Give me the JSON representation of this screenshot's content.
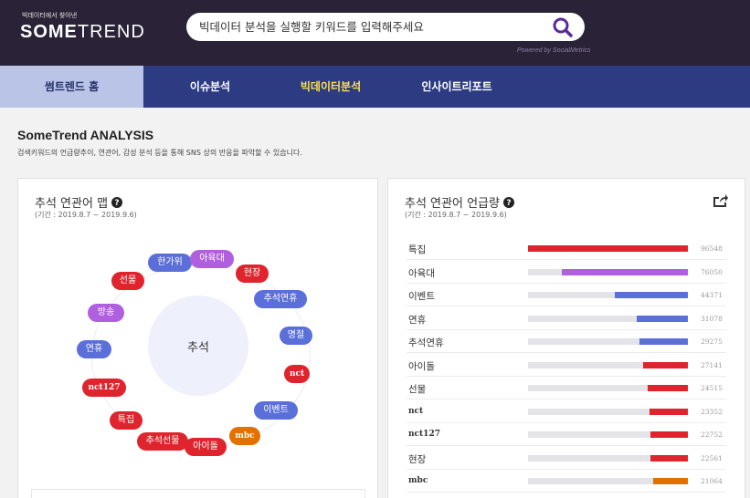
{
  "header": {
    "tagline": "빅데이터에서 찾아낸",
    "logo_bold": "SOME",
    "logo_light": "TREND",
    "search_placeholder": "빅데이터 분석을 실행할 키워드를 입력해주세요",
    "powered_by": "Powered by SocialMetrics"
  },
  "nav": {
    "items": [
      {
        "label": "썸트렌드 홈"
      },
      {
        "label": "이슈분석"
      },
      {
        "label": "빅데이터분석"
      },
      {
        "label": "인사이트리포트"
      }
    ]
  },
  "intro": {
    "title": "SomeTrend ANALYSIS",
    "description": "검색키워드의 언급량추이, 연관어, 감성 분석 등을 통해 SNS 상의 반응을 파악할 수 있습니다."
  },
  "map_panel": {
    "title": "추석 연관어 맵",
    "period": "(기간 : 2019.8.7 ~ 2019.9.6)",
    "center": "추석",
    "chips": [
      {
        "label": "한가위",
        "color": "blue"
      },
      {
        "label": "아육대",
        "color": "purple"
      },
      {
        "label": "현장",
        "color": "red"
      },
      {
        "label": "선물",
        "color": "red"
      },
      {
        "label": "추석연휴",
        "color": "blue"
      },
      {
        "label": "방송",
        "color": "purple"
      },
      {
        "label": "명절",
        "color": "blue"
      },
      {
        "label": "연휴",
        "color": "blue"
      },
      {
        "label": "nct",
        "color": "red"
      },
      {
        "label": "nct127",
        "color": "red"
      },
      {
        "label": "이벤트",
        "color": "blue"
      },
      {
        "label": "특집",
        "color": "red"
      },
      {
        "label": "mbc",
        "color": "orange"
      },
      {
        "label": "추석선물",
        "color": "red"
      },
      {
        "label": "아이돌",
        "color": "red"
      }
    ]
  },
  "volume_panel": {
    "title": "추석 연관어 언급량",
    "period": "(기간 : 2019.8.7 ~ 2019.9.6)",
    "rows": [
      {
        "keyword": "특집",
        "count": "96548",
        "value": 96548,
        "color": "#e0242e"
      },
      {
        "keyword": "아육대",
        "count": "76050",
        "value": 76050,
        "color": "#b05fdf"
      },
      {
        "keyword": "이벤트",
        "count": "44371",
        "value": 44371,
        "color": "#5b6fd8"
      },
      {
        "keyword": "연휴",
        "count": "31078",
        "value": 31078,
        "color": "#5b6fd8"
      },
      {
        "keyword": "추석연휴",
        "count": "29275",
        "value": 29275,
        "color": "#5b6fd8"
      },
      {
        "keyword": "아이돌",
        "count": "27141",
        "value": 27141,
        "color": "#e0242e"
      },
      {
        "keyword": "선물",
        "count": "24515",
        "value": 24515,
        "color": "#e0242e"
      },
      {
        "keyword": "nct",
        "count": "23352",
        "value": 23352,
        "color": "#e0242e"
      },
      {
        "keyword": "nct127",
        "count": "22752",
        "value": 22752,
        "color": "#e0242e"
      },
      {
        "keyword": "현장",
        "count": "22561",
        "value": 22561,
        "color": "#e0242e"
      },
      {
        "keyword": "mbc",
        "count": "21064",
        "value": 21064,
        "color": "#e27200"
      }
    ]
  }
}
